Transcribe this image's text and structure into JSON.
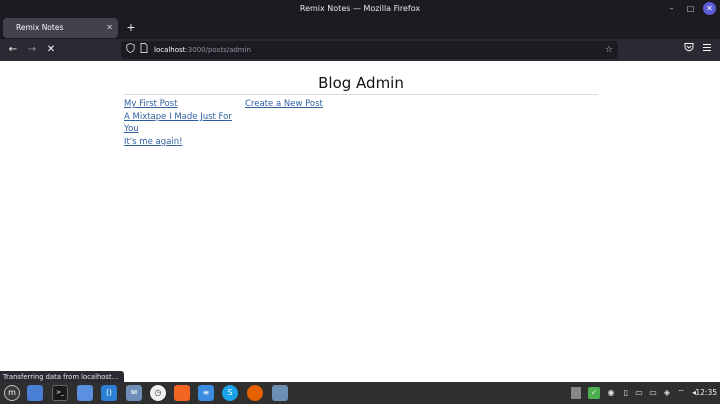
{
  "window": {
    "title": "Remix Notes — Mozilla Firefox",
    "controls": {
      "minimize": "–",
      "maximize": "□",
      "close": "✕"
    }
  },
  "tabs": [
    {
      "label": "Remix Notes",
      "close": "✕"
    }
  ],
  "new_tab": "+",
  "nav": {
    "back": "←",
    "forward": "→",
    "stop": "✕",
    "url_host": "localhost",
    "url_path": ":3000/posts/admin"
  },
  "page": {
    "title": "Blog Admin",
    "posts": [
      "My First Post",
      "A Mixtape I Made Just For You",
      "It's me again!"
    ],
    "create_link": "Create a New Post"
  },
  "status_text": "Transferring data from localhost…",
  "taskbar": {
    "clock": "12:35",
    "apps": [
      "mint-menu-icon",
      "files-icon",
      "terminal-icon",
      "folder-icon",
      "vscode-icon",
      "mail-icon",
      "timeshift-icon",
      "brave-icon",
      "text-editor-icon",
      "skype-icon",
      "firefox-icon",
      "screenshot-icon"
    ]
  },
  "colors": {
    "link": "#2f5fa0",
    "chrome_dark": "#1c1b22",
    "toolbar": "#2b2a33",
    "taskbar": "#2f2f30"
  }
}
